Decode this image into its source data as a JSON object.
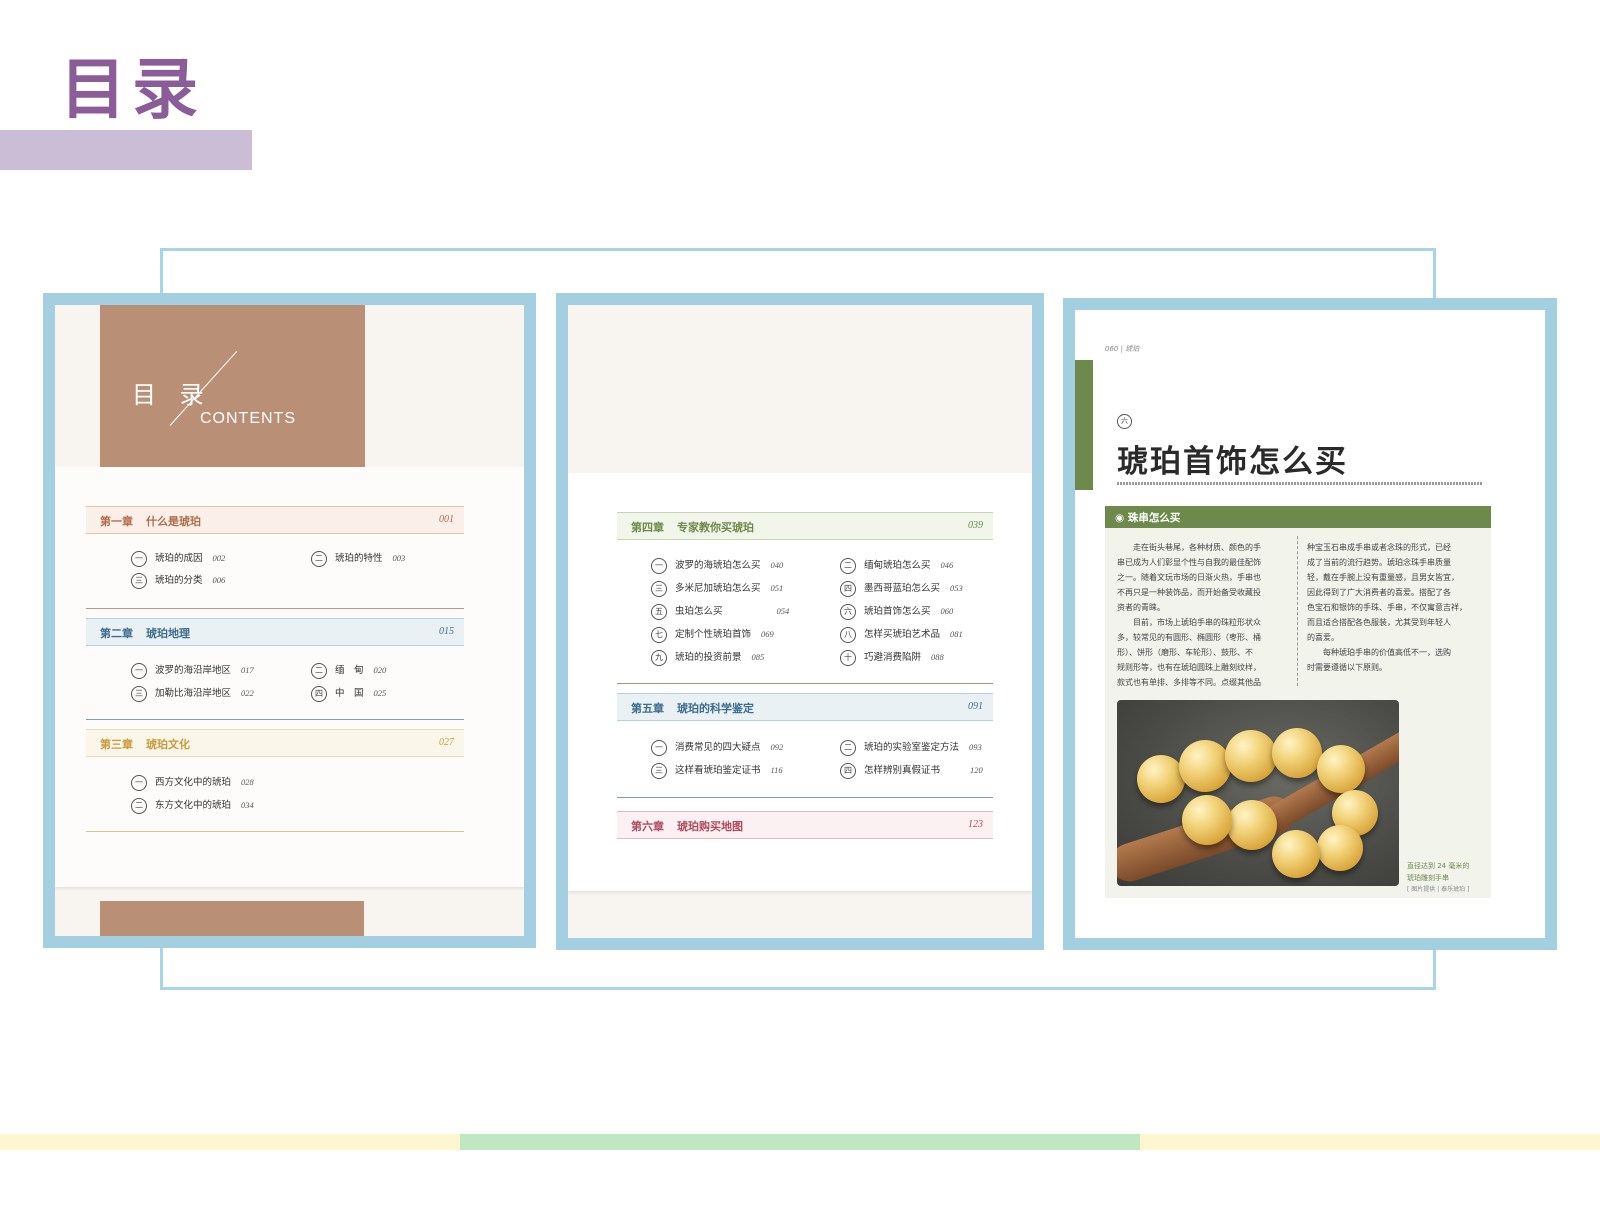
{
  "slide": {
    "title": "目录"
  },
  "panel1": {
    "cover_title": "目 录",
    "cover_sub": "CONTENTS",
    "chapters": [
      {
        "num": "第一章",
        "name": "什么是琥珀",
        "page": "001",
        "items": [
          {
            "mark": "一",
            "text": "琥珀的成因",
            "page": "002"
          },
          {
            "mark": "二",
            "text": "琥珀的特性",
            "page": "003"
          },
          {
            "mark": "三",
            "text": "琥珀的分类",
            "page": "006"
          }
        ]
      },
      {
        "num": "第二章",
        "name": "琥珀地理",
        "page": "015",
        "items": [
          {
            "mark": "一",
            "text": "波罗的海沿岸地区",
            "page": "017"
          },
          {
            "mark": "二",
            "text": "缅　甸",
            "page": "020"
          },
          {
            "mark": "三",
            "text": "加勒比海沿岸地区",
            "page": "022"
          },
          {
            "mark": "四",
            "text": "中　国",
            "page": "025"
          }
        ]
      },
      {
        "num": "第三章",
        "name": "琥珀文化",
        "page": "027",
        "items": [
          {
            "mark": "一",
            "text": "西方文化中的琥珀",
            "page": "028"
          },
          {
            "mark": "二",
            "text": "东方文化中的琥珀",
            "page": "034"
          }
        ]
      }
    ]
  },
  "panel2": {
    "chapters": [
      {
        "num": "第四章",
        "name": "专家教你买琥珀",
        "page": "039",
        "items": [
          {
            "mark": "一",
            "text": "波罗的海琥珀怎么买",
            "page": "040"
          },
          {
            "mark": "二",
            "text": "缅甸琥珀怎么买",
            "page": "046"
          },
          {
            "mark": "三",
            "text": "多米尼加琥珀怎么买",
            "page": "051"
          },
          {
            "mark": "四",
            "text": "墨西哥蓝珀怎么买",
            "page": "053"
          },
          {
            "mark": "五",
            "text": "虫珀怎么买",
            "page": "054"
          },
          {
            "mark": "六",
            "text": "琥珀首饰怎么买",
            "page": "060"
          },
          {
            "mark": "七",
            "text": "定制个性琥珀首饰",
            "page": "069"
          },
          {
            "mark": "八",
            "text": "怎样买琥珀艺术品",
            "page": "081"
          },
          {
            "mark": "九",
            "text": "琥珀的投资前景",
            "page": "085"
          },
          {
            "mark": "十",
            "text": "巧避消费陷阱",
            "page": "088"
          }
        ]
      },
      {
        "num": "第五章",
        "name": "琥珀的科学鉴定",
        "page": "091",
        "items": [
          {
            "mark": "一",
            "text": "消费常见的四大疑点",
            "page": "092"
          },
          {
            "mark": "二",
            "text": "琥珀的实验室鉴定方法",
            "page": "093"
          },
          {
            "mark": "三",
            "text": "这样看琥珀鉴定证书",
            "page": "116"
          },
          {
            "mark": "四",
            "text": "怎样辨别真假证书",
            "page": "120"
          }
        ]
      },
      {
        "num": "第六章",
        "name": "琥珀购买地图",
        "page": "123",
        "items": []
      }
    ]
  },
  "panel3": {
    "running_header": "060 | 琥珀",
    "section_mark": "六",
    "title": "琥珀首饰怎么买",
    "subsection": "◉ 珠串怎么买",
    "col1": [
      "走在街头巷尾，各种材质、颜色的手",
      "串已成为人们彰显个性与自我的最佳配饰",
      "之一。随着文玩市场的日渐火热，手串也",
      "不再只是一种装饰品，而开始备受收藏投",
      "资者的青睐。",
      "目前，市场上琥珀手串的珠粒形状众",
      "多，较常见的有圆形、椭圆形（枣形、桶",
      "形）、饼形（磨形、车轮形）、鼓形、不",
      "规则形等，也有在琥珀圆珠上雕刻纹样，",
      "款式也有单排、多排等不同。点缀其他品"
    ],
    "col2": [
      "种宝玉石串成手串或者念珠的形式，已经",
      "成了当前的流行趋势。琥珀念珠手串质量",
      "轻，戴在手腕上没有重量感，且男女皆宜，",
      "因此得到了广大消费者的喜爱。搭配了各",
      "色宝石和银饰的手珠、手串，不仅寓意吉祥，",
      "而且适合搭配各色服装，尤其受到年轻人",
      "的喜爱。",
      "每种琥珀手串的价值高低不一，选购",
      "时需要遵循以下原则。"
    ],
    "caption": [
      "直径达到 24 毫米的",
      "琥珀雕刻手串",
      "[ 图片提供 | 泰乐琥珀 ]"
    ]
  }
}
